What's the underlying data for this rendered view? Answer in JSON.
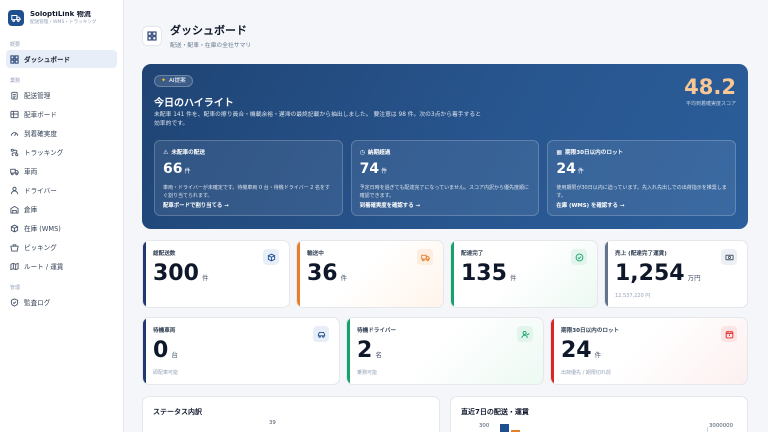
{
  "brand": {
    "name": "SoloptiLink 物流",
    "sub": "配送管理・WMS・トラッキング"
  },
  "sidebar": {
    "sections": [
      {
        "label": "概要",
        "items": [
          {
            "label": "ダッシュボード",
            "icon": "dashboard-icon",
            "active": true
          }
        ]
      },
      {
        "label": "業務",
        "items": [
          {
            "label": "配送管理",
            "icon": "clipboard-icon"
          },
          {
            "label": "配車ボード",
            "icon": "board-icon"
          },
          {
            "label": "到着確実度",
            "icon": "gauge-icon"
          },
          {
            "label": "トラッキング",
            "icon": "route-icon"
          },
          {
            "label": "車両",
            "icon": "truck-icon"
          },
          {
            "label": "ドライバー",
            "icon": "driver-icon"
          },
          {
            "label": "倉庫",
            "icon": "warehouse-icon"
          },
          {
            "label": "在庫 (WMS)",
            "icon": "box-icon"
          },
          {
            "label": "ピッキング",
            "icon": "picking-icon"
          },
          {
            "label": "ルート / 運賃",
            "icon": "map-icon"
          }
        ]
      },
      {
        "label": "管理",
        "items": [
          {
            "label": "監査ログ",
            "icon": "log-icon"
          }
        ]
      }
    ]
  },
  "header": {
    "title": "ダッシュボード",
    "subtitle": "配送・配車・在庫の全社サマリ"
  },
  "hero": {
    "badge": "AI提案",
    "title": "今日のハイライト",
    "description": "未配車 141 件を、配車の擦り員合・機載余裕・遅滞の最終記載から抽出しました。 要注意は 98 件。次の3点から着手すると効率的です。",
    "score_value": "48.2",
    "score_label": "平均到着確実度スコア",
    "cards": [
      {
        "title": "未配車の配送",
        "value": "66",
        "unit": "件",
        "desc": "車両・ドライバーが未確定です。待機車両 0 台・待機ドライバー 2 名をすぐ割り当てられます。",
        "link": "配車ボードで割り当てる →"
      },
      {
        "title": "納期超過",
        "value": "74",
        "unit": "件",
        "desc": "予定日時を過ぎても配達完了になっていません。スコア内訳から優先度順に確認できます。",
        "link": "到着確実度を確認する →"
      },
      {
        "title": "期限30日以内のロット",
        "value": "24",
        "unit": "件",
        "desc": "使用期限が30日以内に迫っています。先入れ先出しでの出荷指示を推奨します。",
        "link": "在庫 (WMS) を確認する →"
      }
    ]
  },
  "stats": [
    {
      "label": "総配送数",
      "value": "300",
      "unit": "件",
      "foot": "",
      "icon": "cube-icon",
      "icon_bg": "#e8eef8",
      "icon_color": "#1e4f8f"
    },
    {
      "label": "輸送中",
      "value": "36",
      "unit": "件",
      "foot": "",
      "icon": "truck-icon",
      "icon_bg": "#fdeedf",
      "icon_color": "#e67e2a"
    },
    {
      "label": "配達完了",
      "value": "135",
      "unit": "件",
      "foot": "",
      "icon": "check-circle-icon",
      "icon_bg": "#e2f5ec",
      "icon_color": "#16a36a"
    },
    {
      "label": "売上 (配達完了運賃)",
      "value": "1,254",
      "unit": "万円",
      "foot": "12,537,220 円",
      "icon": "cash-icon",
      "icon_bg": "#eceff3",
      "icon_color": "#475569"
    },
    {
      "label": "待機車両",
      "value": "0",
      "unit": "台",
      "foot": "即配車可能",
      "icon": "car-icon",
      "icon_bg": "#e8eef8",
      "icon_color": "#1e4f8f"
    },
    {
      "label": "待機ドライバー",
      "value": "2",
      "unit": "名",
      "foot": "乗務可能",
      "icon": "user-check-icon",
      "icon_bg": "#e2f5ec",
      "icon_color": "#16a36a"
    },
    {
      "label": "期限30日以内のロット",
      "value": "24",
      "unit": "件",
      "foot": "出荷優先 / 期限切れ前",
      "icon": "calendar-alert-icon",
      "icon_bg": "#fde4e4",
      "icon_color": "#dc2626"
    }
  ],
  "panels": {
    "status": {
      "title": "ステータス内訳",
      "tick": "39"
    },
    "weekly": {
      "title": "直近7日の配送・運賃",
      "y_tick_left": "300",
      "y_tick_right": "3000000"
    }
  },
  "colors": {
    "primary": "#1e4f8f",
    "hero_bg": "#28558e",
    "score": "#f7c896"
  }
}
